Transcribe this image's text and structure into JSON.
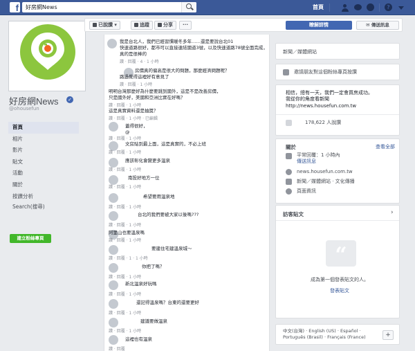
{
  "topbar": {
    "search_value": "好房網News",
    "home": "首頁"
  },
  "page": {
    "name": "好房網News",
    "handle": "@ohousefun"
  },
  "left_nav": [
    "首頁",
    "相片",
    "影片",
    "貼文",
    "活動",
    "關於",
    "按讚分析",
    "Search(搜尋)"
  ],
  "create_page": "建立粉絲專頁",
  "actions": {
    "liked": "已說讚",
    "follow": "追蹤",
    "share": "分享",
    "more": "···",
    "learn_more": "瞭解詳情",
    "message": "傳送訊息"
  },
  "comments": [
    {
      "text": [
        "我是台北人，我們已經習慣暖冬多年……還是要說台北01",
        "快速道路很好，都市可以直接連結國道3號，以及快速道路78號全面完成，真的是很棒的"
      ],
      "meta": "讚 · 回覆 · 4 · 1 小時"
    },
    {
      "text": [
        "房價真的偏高是很大的問題，那麼經濟問題呢？",
        "路過覺得這裡好有意見了"
      ],
      "meta": "讚 · 回覆 · 1 小時"
    },
    {
      "text": [
        "明明台灣那麼好為什麼要跳到國外，這是不是改善房價，",
        "只是國外好，美國和亞洲比實在好嗎？"
      ],
      "meta": "讚 · 回覆 · 1 小時"
    },
    {
      "text": [
        "這是真實資料還是抽獎？"
      ],
      "meta": "讚 · 回覆 · 1 小時 · 已編輯"
    },
    {
      "text": [
        "蓋得很好，",
        "@"
      ],
      "meta": "讚 · 回覆 · 1 小時"
    },
    {
      "text": [
        "文房貼到最上面，這是真實的，不必上班"
      ],
      "meta": "讚 · 回覆 · 1 小時"
    },
    {
      "text": [
        "應該彰化會變更多溫泉"
      ],
      "meta": "讚 · 回覆 · 1 小時"
    },
    {
      "text": [
        "南投好地方一位"
      ],
      "meta": "讚 · 回覆 · 1 小時"
    },
    {
      "text": [
        "希望要用溫泉地"
      ],
      "meta": "讚 · 回覆 · 1 小時"
    },
    {
      "text": [
        "台北的我們要被大家以後嗎???"
      ],
      "meta": "讚 · 回覆 · 1 小時"
    },
    {
      "text": [
        "阿里山也要溫泉嗎"
      ],
      "meta": "讚 · 回覆 · 1 小時"
    },
    {
      "text": [
        "要建住宅建溫泉城～"
      ],
      "meta": "讚 · 回覆 · 1 · 1 小時"
    },
    {
      "text": [
        "你把了嗎？"
      ],
      "meta": "讚 · 回覆 · 1 小時"
    },
    {
      "text": [
        "新北溫泉好玩嗎"
      ],
      "meta": "讚 · 回覆 · 1 小時"
    },
    {
      "text": [
        "還記得溫泉嗎？台東的還要更好"
      ],
      "meta": "讚 · 回覆 · 1 小時"
    },
    {
      "text": [
        "建議要做溫泉"
      ],
      "meta": "讚 · 回覆 · 1 小時"
    },
    {
      "text": [
        "這裡也有溫泉"
      ],
      "meta": "讚 · 回覆"
    }
  ],
  "right": {
    "category": "新聞／媒體網站",
    "invite": "邀請朋友對這個粉絲專頁按讚",
    "about_lines": [
      "相信，總有一天，我們一定會買房成功。",
      "我從你的角度看新聞"
    ],
    "url": "http://news.housefun.com.tw",
    "likes": "178,622 人說讚",
    "about_title": "關於",
    "see_all": "查看全部",
    "info": [
      "平常回覆：1 小時內",
      "傳送訊息",
      "news.housefun.com.tw",
      "新聞／媒體網站 · 文化傳播",
      "頁面資訊"
    ],
    "visitors_title": "訪客貼文",
    "visitors_empty": "成為第一個發表貼文的人。",
    "visitors_cta": "發表貼文",
    "languages": "中文(台灣) · English (US) · Español · Português (Brasil) · Français (France)"
  }
}
